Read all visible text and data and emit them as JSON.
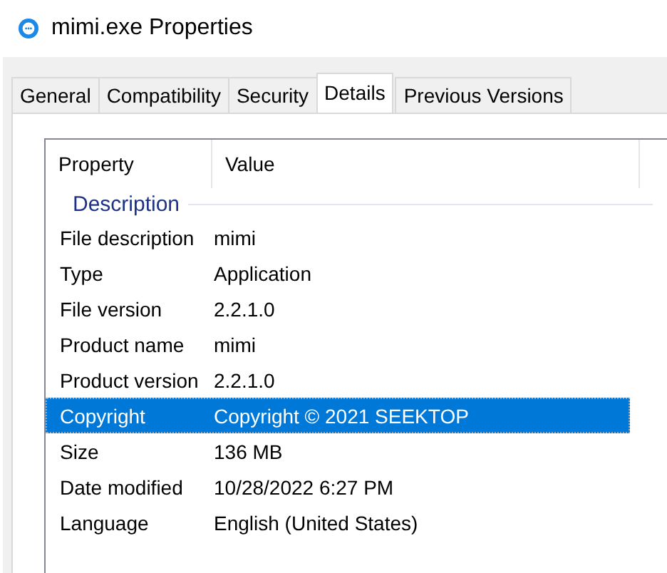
{
  "window": {
    "title": "mimi.exe Properties"
  },
  "tabs": [
    {
      "label": "General",
      "selected": false
    },
    {
      "label": "Compatibility",
      "selected": false
    },
    {
      "label": "Security",
      "selected": false
    },
    {
      "label": "Details",
      "selected": true
    },
    {
      "label": "Previous Versions",
      "selected": false
    }
  ],
  "table": {
    "columns": [
      "Property",
      "Value"
    ],
    "group": "Description",
    "rows": [
      {
        "property": "File description",
        "value": "mimi",
        "selected": false
      },
      {
        "property": "Type",
        "value": "Application",
        "selected": false
      },
      {
        "property": "File version",
        "value": "2.2.1.0",
        "selected": false
      },
      {
        "property": "Product name",
        "value": "mimi",
        "selected": false
      },
      {
        "property": "Product version",
        "value": "2.2.1.0",
        "selected": false
      },
      {
        "property": "Copyright",
        "value": "Copyright © 2021 SEEKTOP",
        "selected": true
      },
      {
        "property": "Size",
        "value": "136 MB",
        "selected": false
      },
      {
        "property": "Date modified",
        "value": "10/28/2022 6:27 PM",
        "selected": false
      },
      {
        "property": "Language",
        "value": "English (United States)",
        "selected": false
      }
    ]
  }
}
